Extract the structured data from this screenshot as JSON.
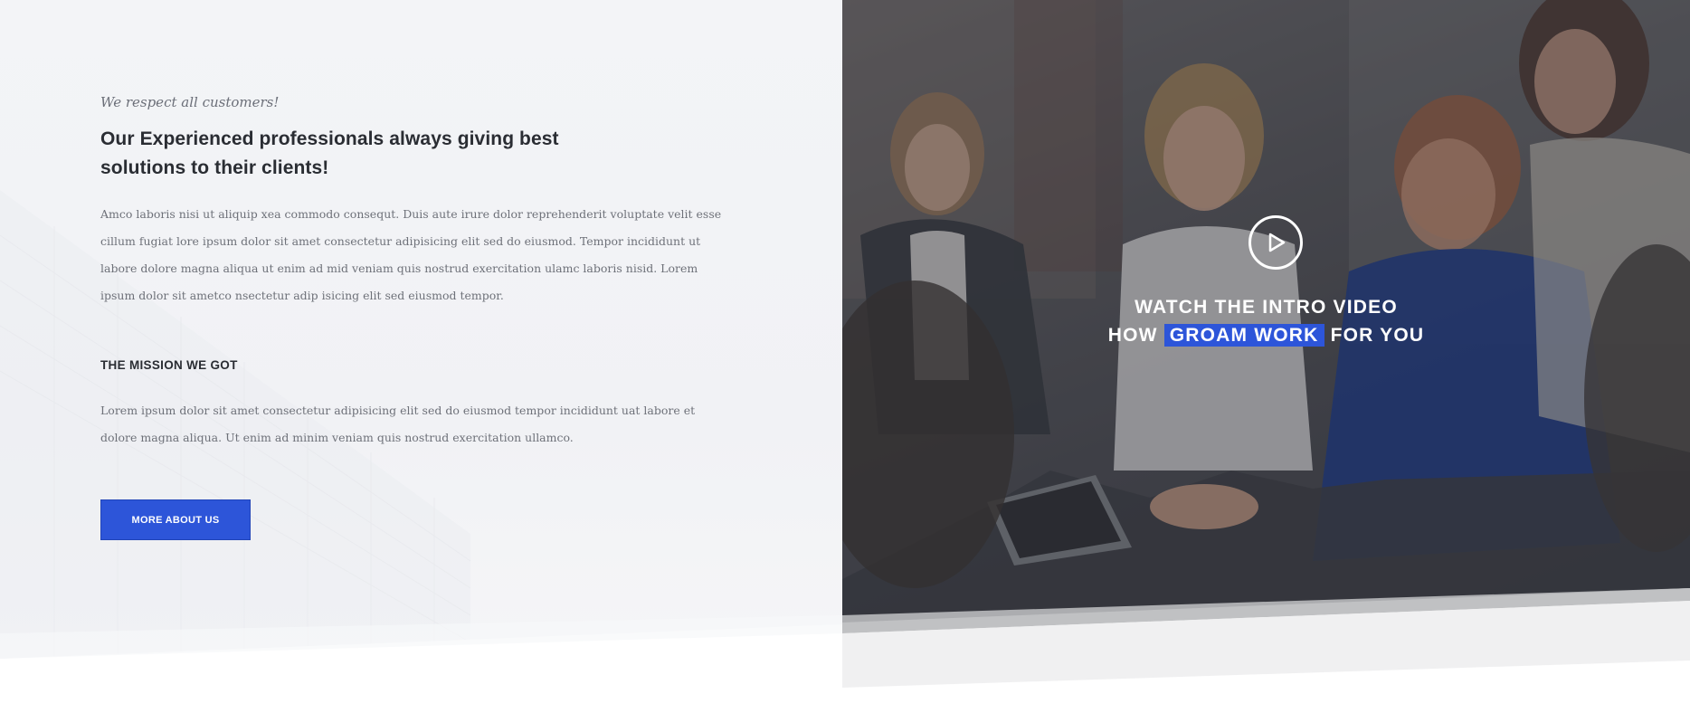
{
  "about": {
    "tagline": "We respect all customers!",
    "headline": "Our Experienced professionals always giving best solutions to their clients!",
    "paragraph": "Amco laboris nisi ut aliquip xea commodo consequt. Duis aute irure dolor reprehenderit voluptate velit esse cillum fugiat lore ipsum dolor sit amet consectetur adipisicing elit sed do eiusmod. Tempor incididunt ut labore dolore magna aliqua ut enim ad mid veniam quis nostrud exercitation ulamc laboris nisid. Lorem ipsum dolor sit  ametco nsectetur adip isicing elit sed eiusmod tempor.",
    "mission_title": "THE MISSION WE GOT",
    "mission_text": "Lorem ipsum dolor sit amet consectetur adipisicing elit sed do eiusmod tempor incididunt uat labore et dolore magna aliqua. Ut enim ad minim veniam quis nostrud exercitation ullamco.",
    "cta_label": "MORE ABOUT US"
  },
  "video": {
    "line1": "WATCH THE INTRO VIDEO",
    "line2_prefix": "HOW",
    "line2_highlight": "GROAM WORK",
    "line2_suffix": "FOR YOU",
    "play_icon": "play-circle-icon"
  },
  "colors": {
    "accent": "#2d55d9",
    "heading": "#2a2d33",
    "body_text": "#6e7179",
    "panel_bg": "#f3f4f7"
  }
}
